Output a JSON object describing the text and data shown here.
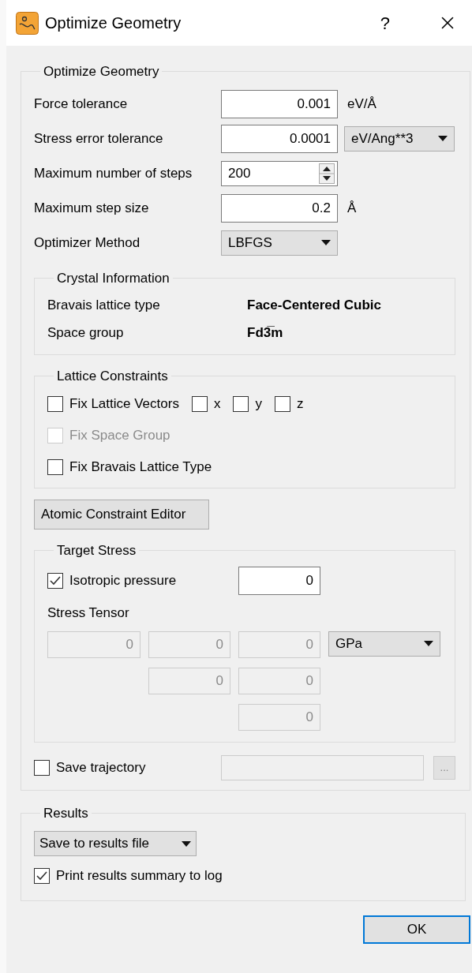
{
  "window": {
    "title": "Optimize Geometry",
    "help": "?"
  },
  "optimize": {
    "legend": "Optimize Geometry",
    "params": [
      {
        "kind": "text",
        "label": "Force tolerance",
        "value": "0.001",
        "unit": "eV/Å"
      },
      {
        "kind": "text_combo",
        "label": "Stress error tolerance",
        "value": "0.0001",
        "unit": "eV/Ang**3"
      },
      {
        "kind": "spin",
        "label": "Maximum number of steps",
        "value": "200"
      },
      {
        "kind": "text",
        "label": "Maximum step size",
        "value": "0.2",
        "unit": "Å"
      },
      {
        "kind": "combo",
        "label": "Optimizer Method",
        "value": "LBFGS"
      }
    ],
    "crystal": {
      "legend": "Crystal Information",
      "rows": [
        {
          "label": "Bravais lattice type",
          "value": "Face-Centered Cubic"
        },
        {
          "label": "Space group",
          "value": "Fd3̅m"
        }
      ]
    },
    "lattice": {
      "legend": "Lattice Constraints",
      "options": [
        {
          "label": "Fix Lattice Vectors",
          "checked": false,
          "disabled": false,
          "axes": [
            {
              "label": "x",
              "checked": false
            },
            {
              "label": "y",
              "checked": false
            },
            {
              "label": "z",
              "checked": false
            }
          ]
        },
        {
          "label": "Fix Space Group",
          "checked": false,
          "disabled": true
        },
        {
          "label": "Fix Bravais Lattice Type",
          "checked": false,
          "disabled": false
        }
      ]
    },
    "atomic_button": "Atomic Constraint Editor",
    "target_stress": {
      "legend": "Target Stress",
      "isotropic": {
        "label": "Isotropic pressure",
        "checked": true,
        "value": "0"
      },
      "tensor_label": "Stress Tensor",
      "tensor": {
        "disabled": true,
        "rows": [
          [
            "0",
            "0",
            "0"
          ],
          [
            "",
            "0",
            "0"
          ],
          [
            "",
            "",
            "0"
          ]
        ]
      },
      "unit": "GPa"
    },
    "save_trajectory": {
      "label": "Save trajectory",
      "checked": false,
      "path_disabled": true,
      "browse": "..."
    }
  },
  "results": {
    "legend": "Results",
    "mode": "Save to results file",
    "print_summary": {
      "label": "Print results summary to log",
      "checked": true
    }
  },
  "ok": "OK"
}
